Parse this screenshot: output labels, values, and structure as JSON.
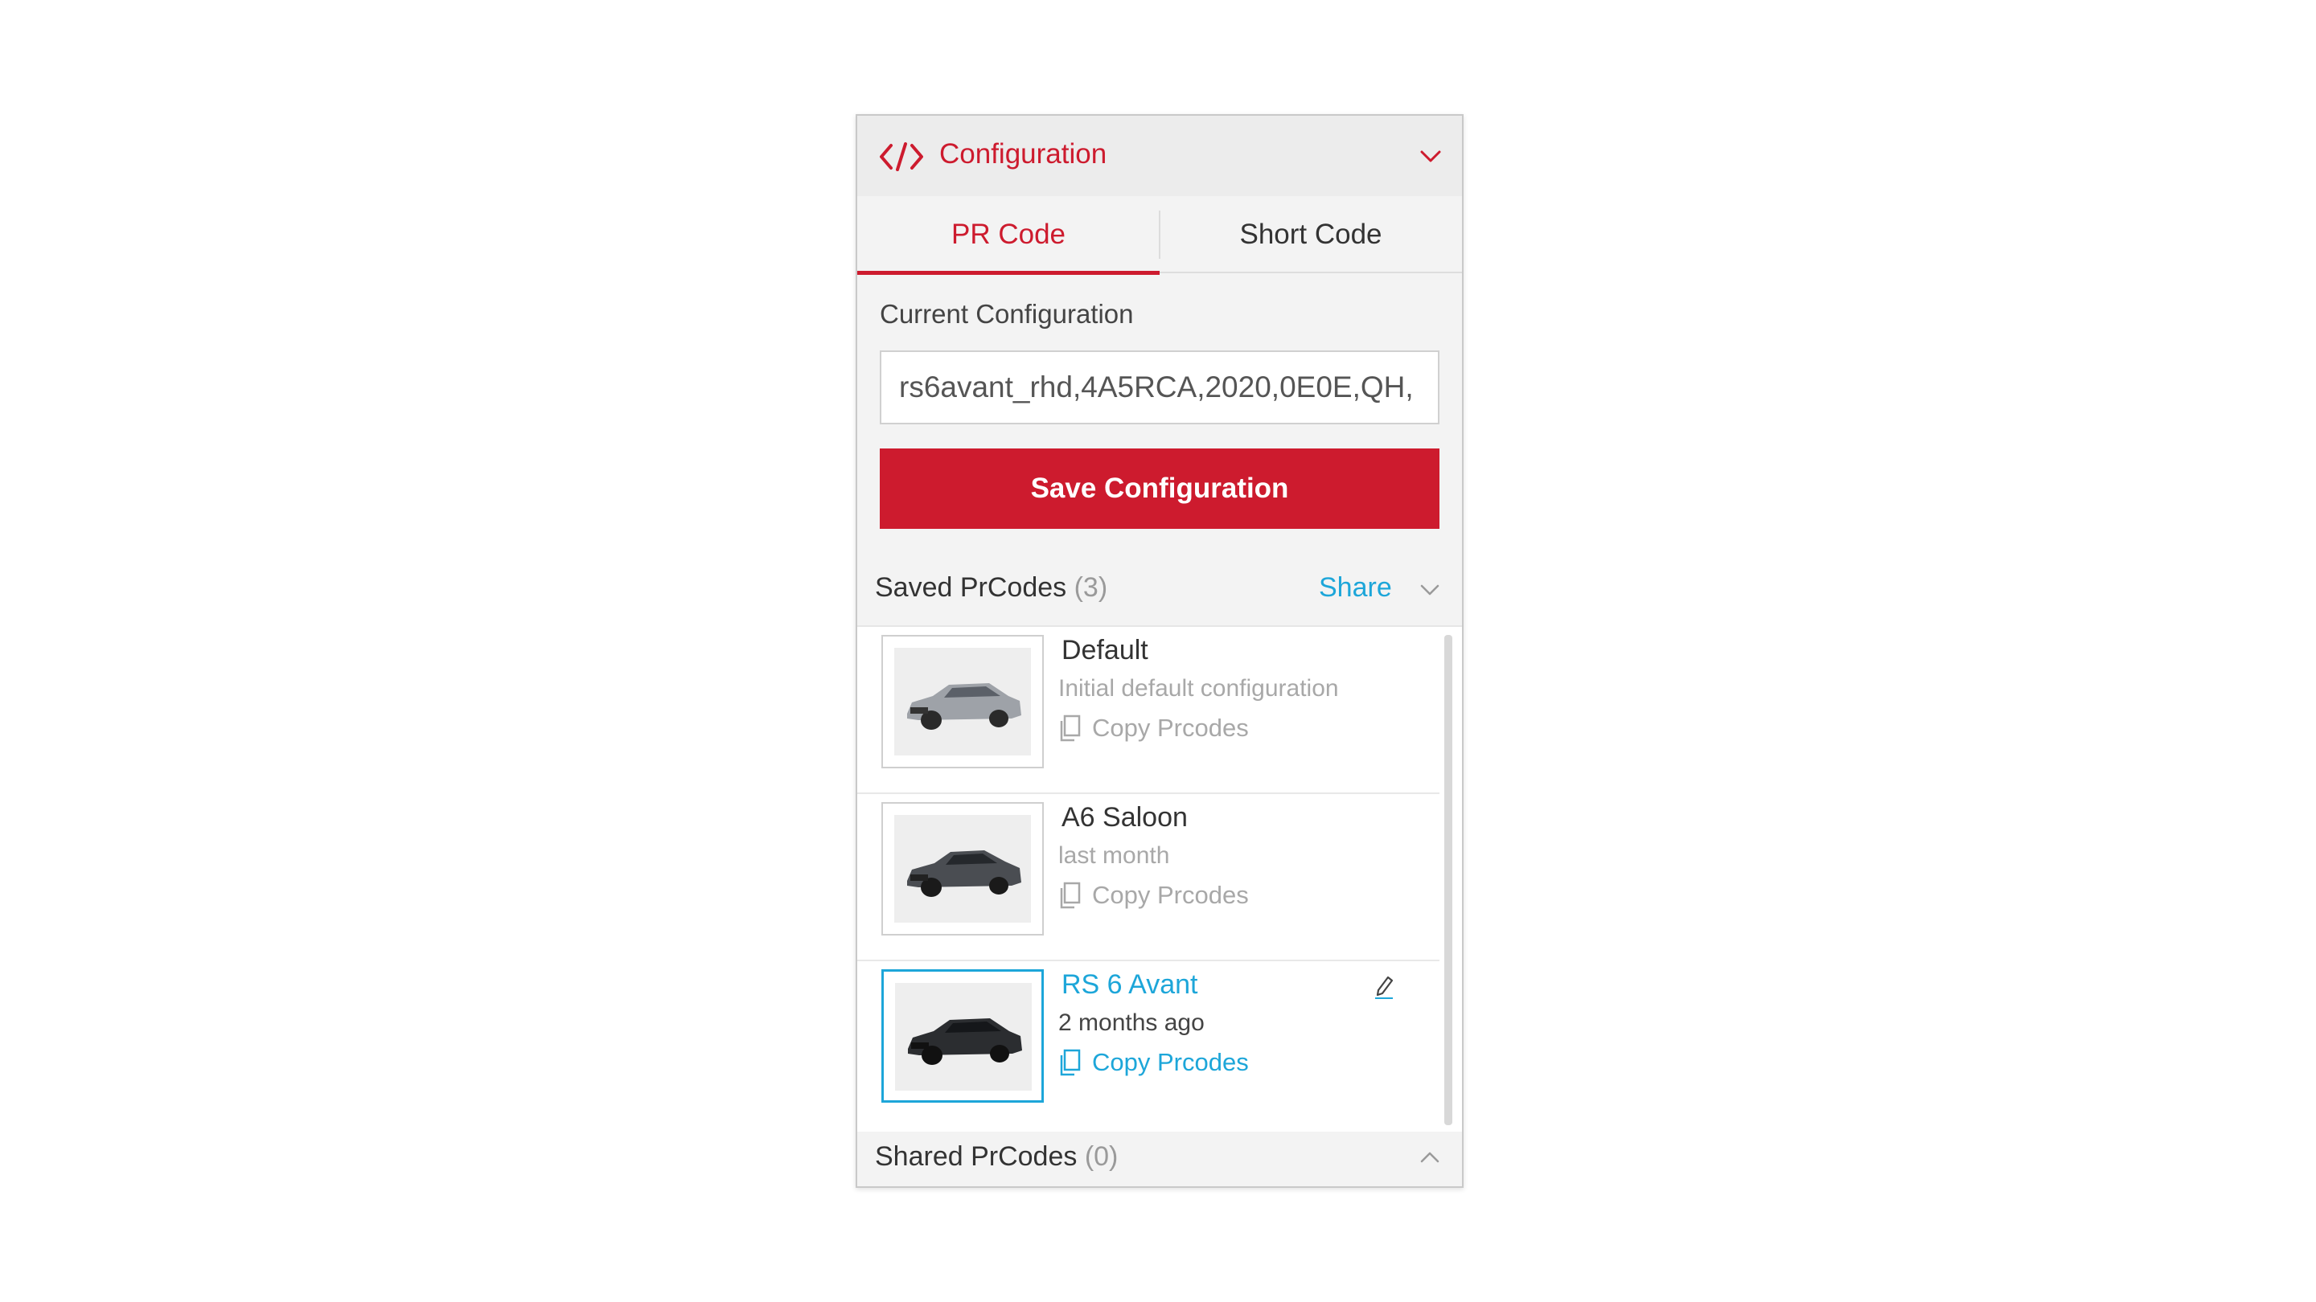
{
  "header": {
    "title": "Configuration",
    "icon": "code-icon",
    "accent_color": "#cd1b2e"
  },
  "tabs": [
    {
      "label": "PR Code",
      "active": true
    },
    {
      "label": "Short Code",
      "active": false
    }
  ],
  "current_configuration": {
    "label": "Current Configuration",
    "value": "rs6avant_rhd,4A5RCA,2020,0E0E,QH,"
  },
  "save_button": {
    "label": "Save Configuration",
    "color": "#cd1b2e"
  },
  "saved": {
    "title": "Saved PrCodes",
    "count": "(3)",
    "share_label": "Share",
    "link_color": "#1da6d9",
    "items": [
      {
        "title": "Default",
        "subtitle": "Initial default configuration",
        "copy_label": "Copy Prcodes",
        "car_color": "#9ea2a8",
        "selected": false
      },
      {
        "title": "A6 Saloon",
        "subtitle": "last month",
        "copy_label": "Copy Prcodes",
        "car_color": "#4a4d52",
        "selected": false
      },
      {
        "title": "RS 6 Avant",
        "subtitle": "2 months ago",
        "copy_label": "Copy Prcodes",
        "car_color": "#2b2d30",
        "selected": true
      }
    ]
  },
  "shared": {
    "title": "Shared PrCodes",
    "count": "(0)"
  }
}
